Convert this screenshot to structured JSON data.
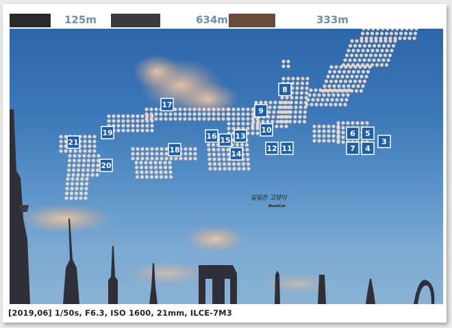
{
  "top_strip": [
    {
      "text": "125m"
    },
    {
      "text": "634m"
    },
    {
      "text": "333m"
    }
  ],
  "map_markers": [
    "17",
    "8",
    "9",
    "10",
    "21",
    "19",
    "16",
    "15",
    "13",
    "14",
    "18",
    "20",
    "12",
    "11",
    "6",
    "5",
    "3",
    "7",
    "4"
  ],
  "watermark": {
    "script": "길잃은 고양이",
    "small": "BlackCat"
  },
  "caption": "[2019,06]  1/50s,  F6.3,  ISO 1600,  21mm,  ILCE-7M3",
  "colors": {
    "sky": "#3d78b8",
    "marker": "#1f5fa8",
    "dots": "#f1dccb"
  }
}
